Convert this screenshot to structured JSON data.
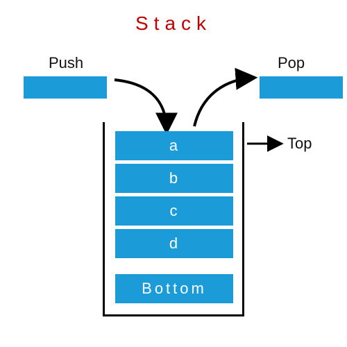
{
  "title": "Stack",
  "labels": {
    "push": "Push",
    "pop": "Pop",
    "top": "Top"
  },
  "colors": {
    "accent": "#1b9bd8",
    "title": "#c00000",
    "stroke": "#000000",
    "cell_text": "#ffffff"
  },
  "stack": {
    "cells": [
      "a",
      "b",
      "c",
      "d",
      "Bottom"
    ],
    "top_index": 0
  }
}
